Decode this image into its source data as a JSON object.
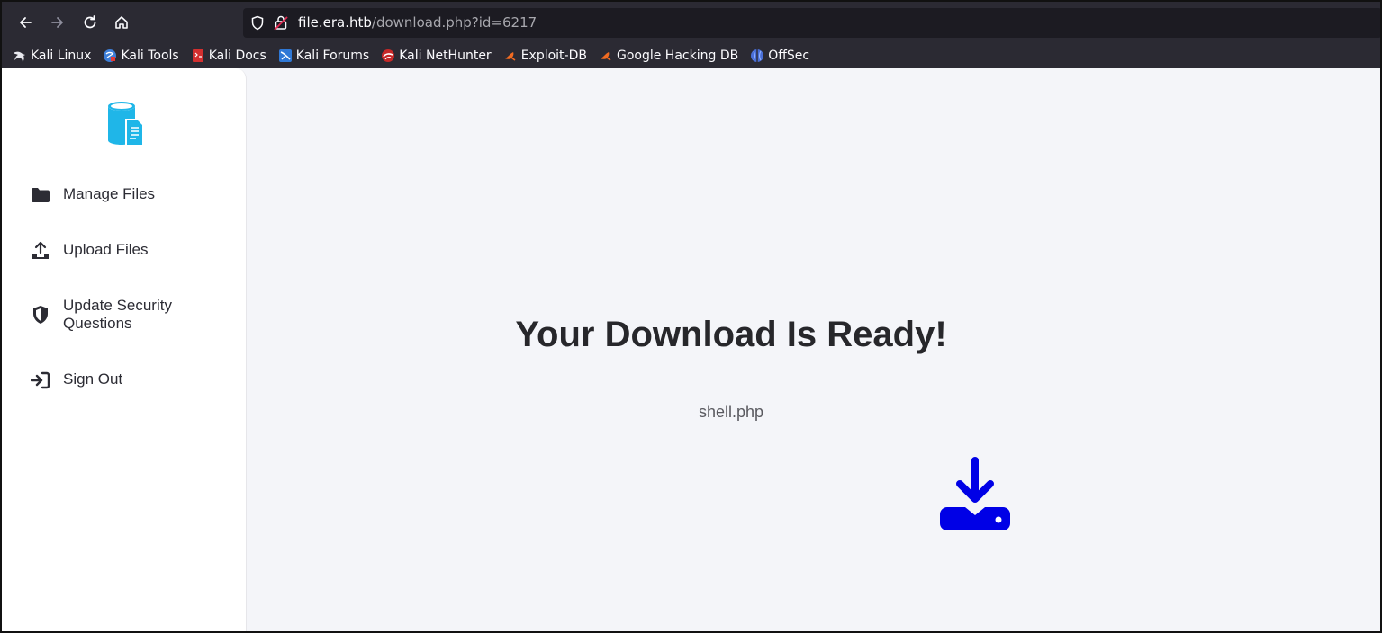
{
  "browser": {
    "url_host": "file.era.htb",
    "url_path": "/download.php?id=6217"
  },
  "bookmarks": [
    {
      "label": "Kali Linux",
      "icon": "kali-dragon-icon"
    },
    {
      "label": "Kali Tools",
      "icon": "kali-tools-icon"
    },
    {
      "label": "Kali Docs",
      "icon": "kali-docs-icon"
    },
    {
      "label": "Kali Forums",
      "icon": "kali-forums-icon"
    },
    {
      "label": "Kali NetHunter",
      "icon": "nethunter-icon"
    },
    {
      "label": "Exploit-DB",
      "icon": "exploit-db-icon"
    },
    {
      "label": "Google Hacking DB",
      "icon": "ghdb-icon"
    },
    {
      "label": "OffSec",
      "icon": "offsec-icon"
    }
  ],
  "sidebar": {
    "logo_icon": "file-database-icon",
    "items": [
      {
        "label": "Manage Files",
        "icon": "folder-icon"
      },
      {
        "label": "Upload Files",
        "icon": "upload-icon"
      },
      {
        "label": "Update Security Questions",
        "icon": "shield-icon"
      },
      {
        "label": "Sign Out",
        "icon": "sign-out-icon"
      }
    ]
  },
  "main": {
    "title": "Your Download Is Ready!",
    "filename": "shell.php",
    "download_icon": "download-drive-icon"
  },
  "colors": {
    "accent_blue": "#0000e6",
    "logo_cyan": "#1fb6e8"
  }
}
